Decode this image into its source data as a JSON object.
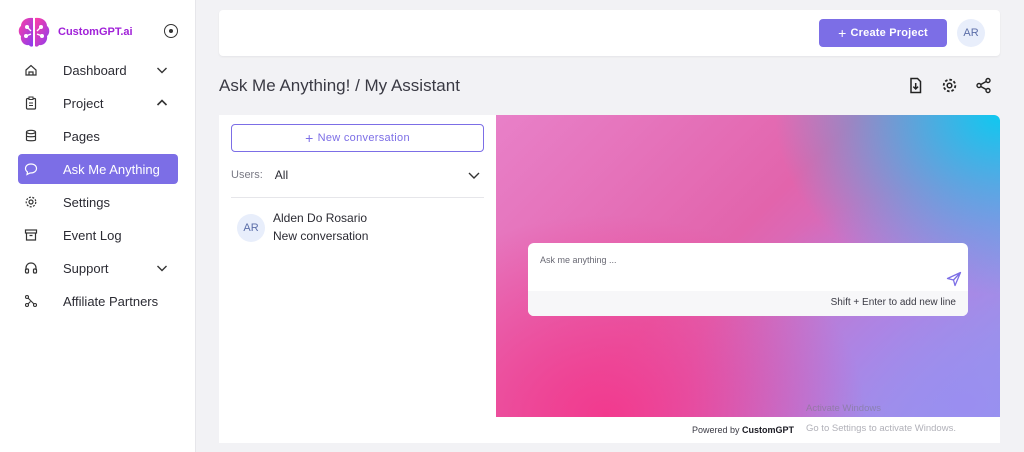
{
  "brand": {
    "name": "CustomGPT.ai"
  },
  "sidebar": {
    "items": [
      {
        "label": "Dashboard",
        "icon": "home-icon",
        "expand": "down"
      },
      {
        "label": "Project",
        "icon": "clipboard-icon",
        "expand": "up"
      },
      {
        "label": "Pages",
        "icon": "database-icon"
      },
      {
        "label": "Ask Me Anything",
        "icon": "chat-bubble-icon",
        "active": true
      },
      {
        "label": "Settings",
        "icon": "gear-icon"
      },
      {
        "label": "Event Log",
        "icon": "archive-icon"
      },
      {
        "label": "Support",
        "icon": "headphones-icon",
        "expand": "down"
      },
      {
        "label": "Affiliate Partners",
        "icon": "affiliate-icon"
      }
    ]
  },
  "header": {
    "create_label": "Create Project",
    "avatar_initials": "AR"
  },
  "page": {
    "title": "Ask Me Anything! / My Assistant"
  },
  "conversations": {
    "new_label": "New conversation",
    "users_label": "Users:",
    "users_value": "All",
    "items": [
      {
        "initials": "AR",
        "name": "Alden Do Rosario",
        "subtitle": "New conversation"
      }
    ]
  },
  "chat": {
    "placeholder": "Ask me anything ...",
    "hint": "Shift + Enter to add new line",
    "powered_prefix": "Powered by",
    "powered_brand": "CustomGPT"
  },
  "watermark": {
    "line1": "Activate Windows",
    "line2": "Go to Settings to activate Windows."
  },
  "colors": {
    "accent": "#7c6ee6",
    "brand": "#a020d8"
  }
}
